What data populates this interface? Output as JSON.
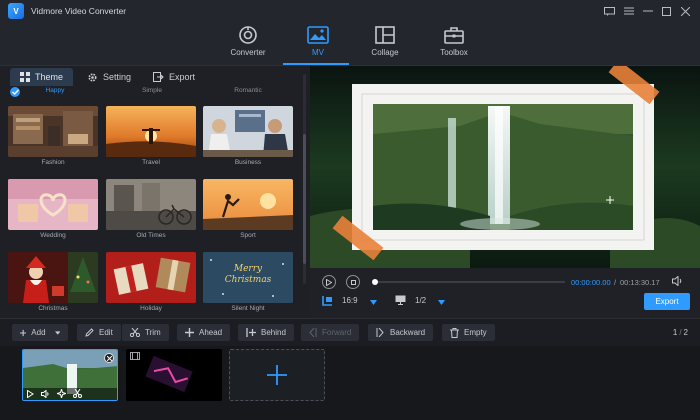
{
  "app": {
    "title": "Vidmore Video Converter",
    "logo_text": "V"
  },
  "window_controls": [
    "chat-icon",
    "menu-icon",
    "minimize-icon",
    "maximize-icon",
    "close-icon"
  ],
  "main_nav": {
    "tabs": [
      {
        "label": "Converter",
        "icon": "converter-icon",
        "active": false
      },
      {
        "label": "MV",
        "icon": "mv-icon",
        "active": true
      },
      {
        "label": "Collage",
        "icon": "collage-icon",
        "active": false
      },
      {
        "label": "Toolbox",
        "icon": "toolbox-icon",
        "active": false
      }
    ]
  },
  "sub_tabs": [
    {
      "label": "Theme",
      "icon": "theme-icon",
      "active": true
    },
    {
      "label": "Setting",
      "icon": "gear-icon",
      "active": false
    },
    {
      "label": "Export",
      "icon": "export-icon",
      "active": false
    }
  ],
  "themes": {
    "top_row_labels": [
      "Happy",
      "Simple",
      "Romantic"
    ],
    "items": [
      {
        "name": "Fashion"
      },
      {
        "name": "Travel"
      },
      {
        "name": "Business"
      },
      {
        "name": "Wedding"
      },
      {
        "name": "Old Times"
      },
      {
        "name": "Sport"
      },
      {
        "name": "Christmas"
      },
      {
        "name": "Holiday"
      },
      {
        "name": "Silent Night",
        "overlay_text": "Merry Christmas"
      }
    ]
  },
  "player": {
    "time_current": "00:00:00.00",
    "time_separator": "/",
    "time_total": "00:13:30.17",
    "progress": 0.0,
    "aspect_ratio": "16:9",
    "page": "1/2",
    "export_label": "Export"
  },
  "toolbar": {
    "buttons": [
      {
        "label": "Add",
        "icon": "plus-icon",
        "enabled": true
      },
      {
        "label": "Edit",
        "icon": "edit-icon",
        "enabled": true
      },
      {
        "label": "Trim",
        "icon": "scissors-icon",
        "enabled": true
      },
      {
        "label": "Ahead",
        "icon": "ahead-icon",
        "enabled": true
      },
      {
        "label": "Behind",
        "icon": "behind-icon",
        "enabled": true
      },
      {
        "label": "Forward",
        "icon": "forward-icon",
        "enabled": false
      },
      {
        "label": "Backward",
        "icon": "backward-icon",
        "enabled": true
      },
      {
        "label": "Empty",
        "icon": "trash-icon",
        "enabled": true
      }
    ],
    "page_current": "1",
    "page_sep": "/",
    "page_total": "2"
  },
  "colors": {
    "accent": "#2f9bff",
    "background": "#1b1d22",
    "panel": "#23262d"
  }
}
